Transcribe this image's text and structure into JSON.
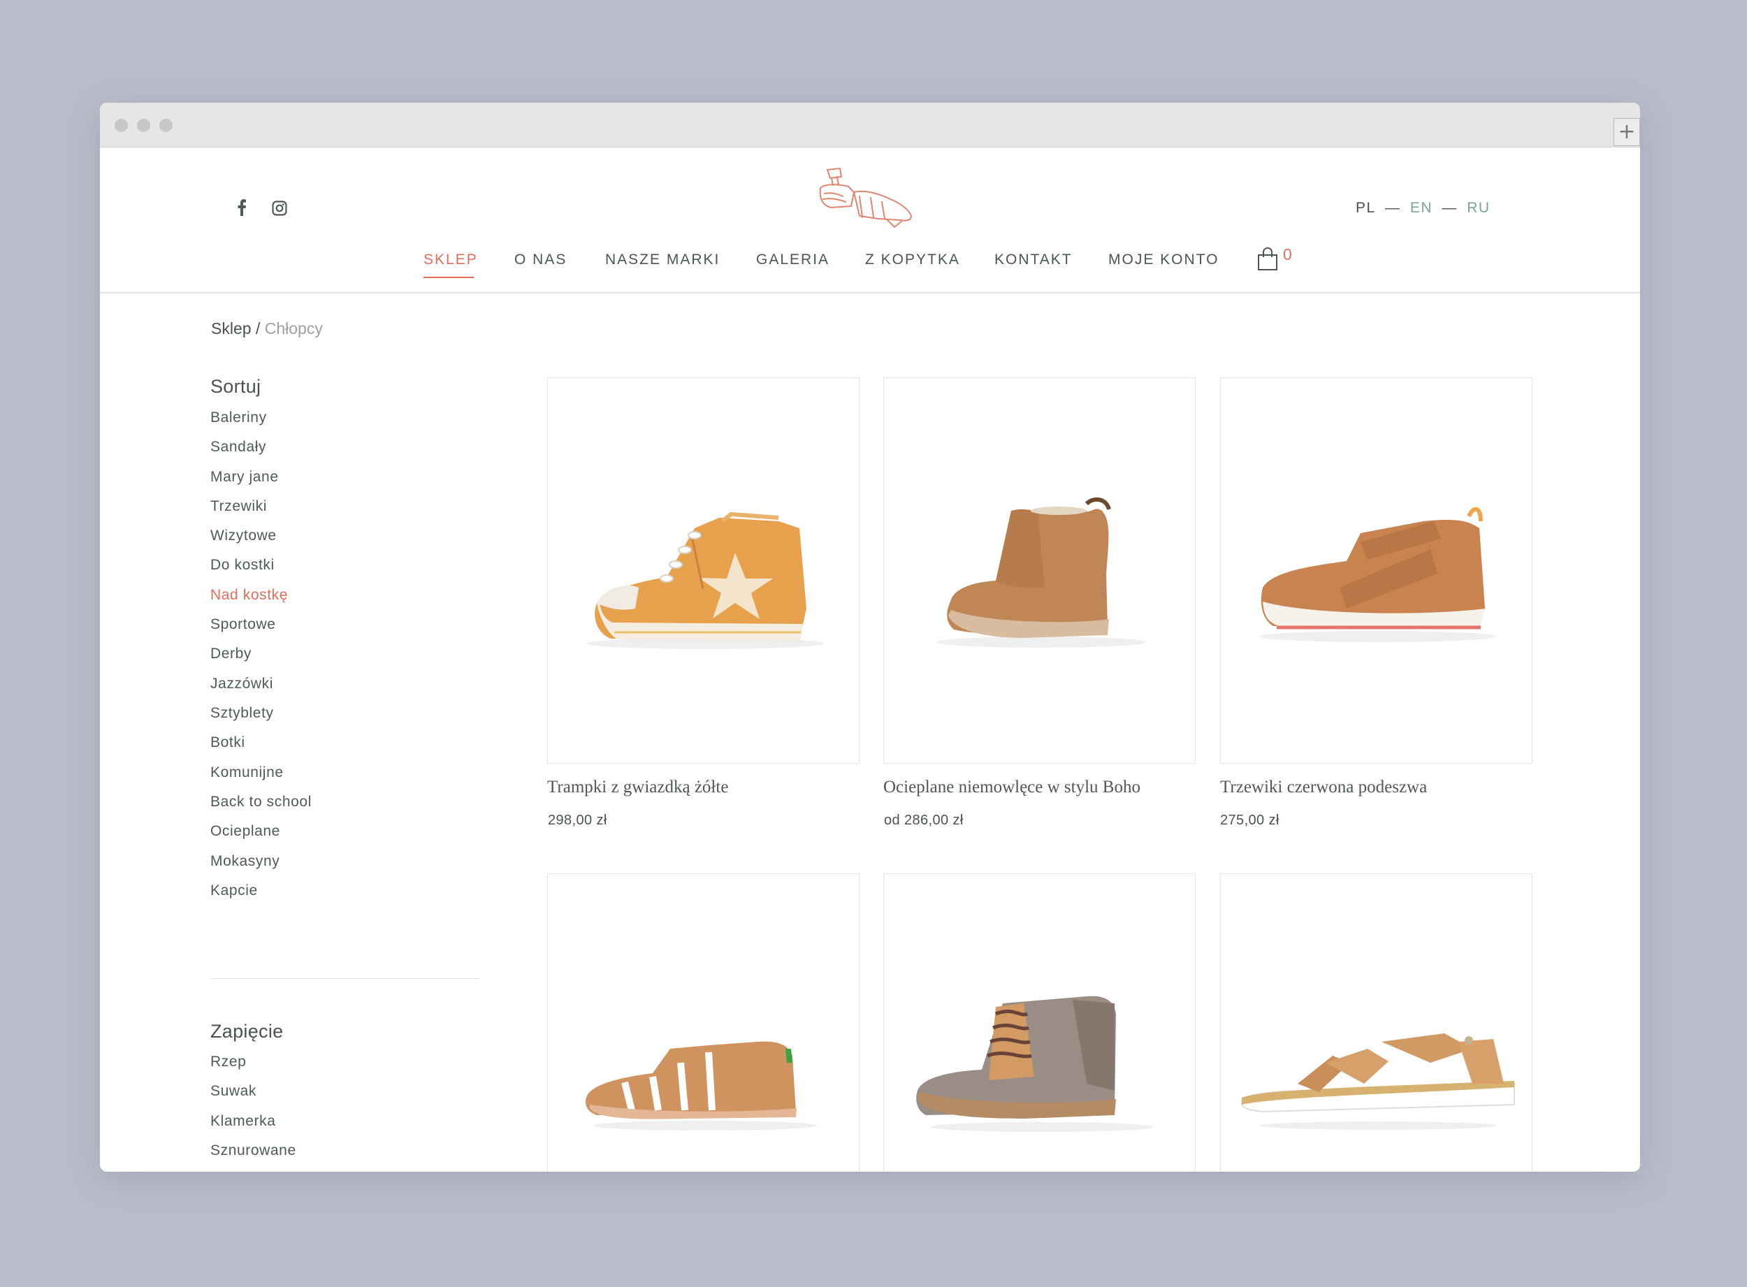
{
  "social": {
    "facebook_icon": "facebook-icon",
    "instagram_icon": "instagram-icon"
  },
  "logo": {
    "icon": "shoe-last-logo"
  },
  "languages": [
    {
      "code": "PL",
      "active": true
    },
    {
      "code": "EN",
      "active": false
    },
    {
      "code": "RU",
      "active": false
    }
  ],
  "lang_separator": "—",
  "nav": {
    "items": [
      "SKLEP",
      "O NAS",
      "NASZE MARKI",
      "GALERIA",
      "Z KOPYTKA",
      "KONTAKT",
      "MOJE KONTO"
    ],
    "active": "SKLEP",
    "cart_icon": "shopping-bag-icon",
    "cart_count": "0"
  },
  "breadcrumb": {
    "root": "Sklep",
    "separator": "/",
    "current": "Chłopcy"
  },
  "sidebar": {
    "sort_title": "Sortuj",
    "sort_items": [
      "Baleriny",
      "Sandały",
      "Mary jane",
      "Trzewiki",
      "Wizytowe",
      "Do kostki",
      "Nad kostkę",
      "Sportowe",
      "Derby",
      "Jazzówki",
      "Sztyblety",
      "Botki",
      "Komunijne",
      "Back to school",
      "Ocieplane",
      "Mokasyny",
      "Kapcie"
    ],
    "sort_active": "Nad kostkę",
    "fastening_title": "Zapięcie",
    "fastening_items": [
      "Rzep",
      "Suwak",
      "Klamerka",
      "Sznurowane"
    ]
  },
  "products": [
    {
      "name": "Trampki z gwiazdką żółte",
      "price": "298,00 zł",
      "image": "yellow-star-sneaker"
    },
    {
      "name": "Ocieplane niemowlęce w stylu Boho",
      "price": "od 286,00 zł",
      "image": "brown-baby-boot"
    },
    {
      "name": "Trzewiki czerwona podeszwa",
      "price": "275,00 zł",
      "image": "tan-velcro-boot"
    },
    {
      "image": "tan-sandal"
    },
    {
      "image": "grey-lace-up-boot"
    },
    {
      "image": "tan-bow-sandal"
    }
  ],
  "colors": {
    "accent": "#e26d5a",
    "text": "#4b5553",
    "muted": "#9aa19f",
    "background": "#babdc9"
  }
}
